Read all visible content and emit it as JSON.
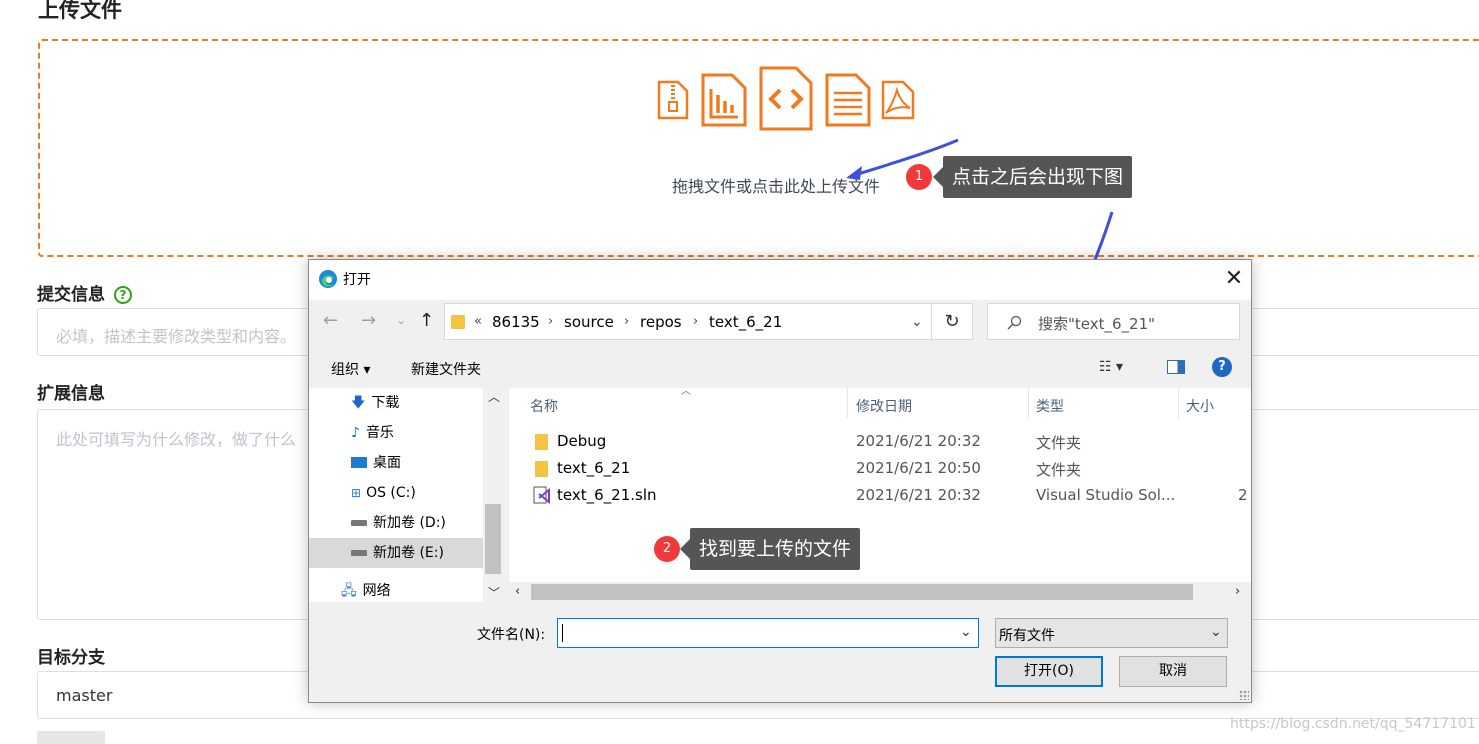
{
  "page": {
    "title": "上传文件",
    "drop_text": "拖拽文件或点击此处上传文件",
    "commit_label": "提交信息",
    "commit_help_icon": "question-circle-icon",
    "commit_placeholder": "必填，描述主要修改类型和内容。",
    "ext_label": "扩展信息",
    "ext_placeholder": "此处可填写为什么修改，做了什么",
    "branch_label": "目标分支",
    "branch_value": "master",
    "watermark": "https://blog.csdn.net/qq_54717101",
    "accent_color": "#f07a1d",
    "file_icons": [
      "zip-file-icon",
      "chart-file-icon",
      "code-file-icon",
      "text-file-icon",
      "pdf-file-icon"
    ]
  },
  "annotations": {
    "step1_badge": "1",
    "step1_text": "点击之后会出现下图",
    "step2_badge": "2",
    "step2_text": "找到要上传的文件"
  },
  "dialog": {
    "title": "打开",
    "close_glyph": "✕",
    "breadcrumb": {
      "overflow": "«",
      "parts": [
        "86135",
        "source",
        "repos",
        "text_6_21"
      ]
    },
    "search_placeholder": "搜索\"text_6_21\"",
    "toolbar": {
      "organize": "组织 ▾",
      "new_folder": "新建文件夹"
    },
    "nav_items": [
      {
        "label": "下载",
        "icon": "download-icon"
      },
      {
        "label": "音乐",
        "icon": "music-icon"
      },
      {
        "label": "桌面",
        "icon": "desktop-icon"
      },
      {
        "label": "OS (C:)",
        "icon": "windows-drive-icon"
      },
      {
        "label": "新加卷 (D:)",
        "icon": "drive-icon"
      },
      {
        "label": "新加卷 (E:)",
        "icon": "drive-icon",
        "selected": true
      },
      {
        "label": "网络",
        "icon": "network-icon"
      }
    ],
    "columns": [
      "名称",
      "修改日期",
      "类型",
      "大小"
    ],
    "files": [
      {
        "name": "Debug",
        "date": "2021/6/21 20:32",
        "type": "文件夹",
        "size": "",
        "icon": "folder-icon"
      },
      {
        "name": "text_6_21",
        "date": "2021/6/21 20:50",
        "type": "文件夹",
        "size": "",
        "icon": "folder-icon"
      },
      {
        "name": "text_6_21.sln",
        "date": "2021/6/21 20:32",
        "type": "Visual Studio Sol...",
        "size": "2",
        "icon": "visual-studio-solution-icon"
      }
    ],
    "filename_label": "文件名(N):",
    "filename_value": "",
    "filetype_value": "所有文件",
    "open_button": "打开(O)",
    "cancel_button": "取消"
  }
}
